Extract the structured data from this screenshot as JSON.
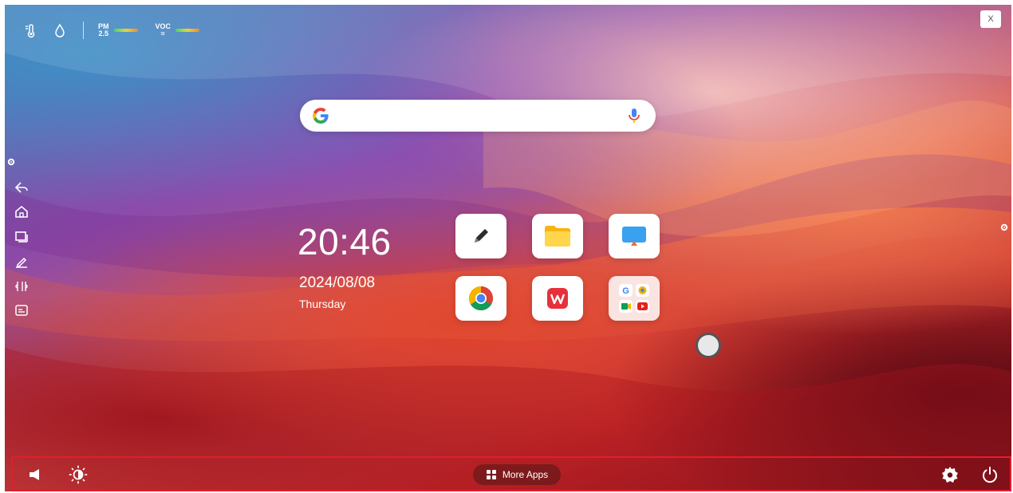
{
  "status_bar": {
    "icons": [
      "thermometer-icon",
      "humidity-drop-icon"
    ],
    "pm_label_top": "PM",
    "pm_label_bottom": "2.5",
    "voc_label": "VOC",
    "bar_gradient": [
      "#49d36a",
      "#e7d43a",
      "#f08a2a"
    ]
  },
  "close_label": "X",
  "search": {
    "placeholder": "",
    "value": "",
    "icons": [
      "google-logo-icon",
      "microphone-icon"
    ]
  },
  "sidebar": {
    "items": [
      {
        "icon": "settings-handle-icon"
      },
      {
        "icon": "back-icon"
      },
      {
        "icon": "home-icon"
      },
      {
        "icon": "windows-icon"
      },
      {
        "icon": "annotate-pen-icon"
      },
      {
        "icon": "source-icon"
      },
      {
        "icon": "presentation-icon"
      }
    ]
  },
  "clock": {
    "time": "20:46",
    "date": "2024/08/08",
    "weekday": "Thursday"
  },
  "apps": [
    {
      "name": "note-pen-app",
      "icon": "pen-icon"
    },
    {
      "name": "file-manager-app",
      "icon": "folder-icon"
    },
    {
      "name": "screen-share-app",
      "icon": "screen-cast-icon"
    },
    {
      "name": "chrome-app",
      "icon": "chrome-icon"
    },
    {
      "name": "wps-office-app",
      "icon": "wps-icon"
    },
    {
      "name": "google-apps-folder",
      "icon": "google-folder-icon"
    }
  ],
  "dock": {
    "more_apps_label": "More Apps",
    "icons": [
      "volume-icon",
      "brightness-icon",
      "settings-icon",
      "power-icon"
    ],
    "highlight_color": "#e21e2b"
  },
  "colors": {
    "accent_red": "#e21e2b",
    "google_blue": "#4285f4",
    "google_red": "#ea4335",
    "google_yellow": "#fbbc05",
    "google_green": "#34a853"
  }
}
